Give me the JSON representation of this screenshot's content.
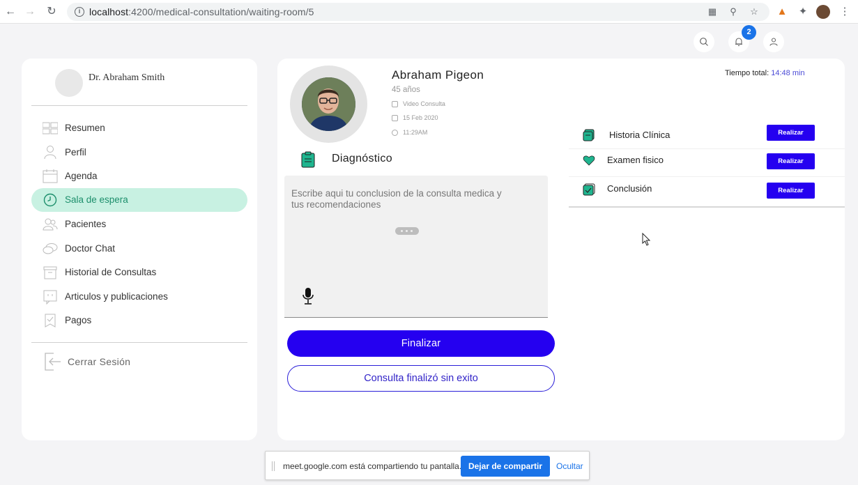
{
  "browser": {
    "url_host": "localhost",
    "url_path": ":4200/medical-consultation/waiting-room/5"
  },
  "header": {
    "notification_count": "2"
  },
  "sidebar": {
    "doctor_name": "Dr. Abraham Smith",
    "items": [
      {
        "label": "Resumen",
        "icon": "grid-icon"
      },
      {
        "label": "Perfil",
        "icon": "user-icon"
      },
      {
        "label": "Agenda",
        "icon": "calendar-icon"
      },
      {
        "label": "Sala de espera",
        "icon": "clock-icon",
        "active": true
      },
      {
        "label": "Pacientes",
        "icon": "patients-icon"
      },
      {
        "label": "Doctor Chat",
        "icon": "chat-icon"
      },
      {
        "label": "Historial de Consultas",
        "icon": "archive-icon"
      },
      {
        "label": "Articulos y publicaciones",
        "icon": "articles-icon"
      },
      {
        "label": "Pagos",
        "icon": "payments-icon"
      }
    ],
    "logout_label": "Cerrar Sesión"
  },
  "patient": {
    "name": "Abraham Pigeon",
    "age": "45 años",
    "consult_type": "Video Consulta",
    "date": "15 Feb 2020",
    "time": "11:29AM"
  },
  "timer": {
    "label": "Tiempo total:",
    "value": "14:48 min"
  },
  "diagnosis": {
    "title": "Diagnóstico",
    "placeholder": "Escribe aqui tu conclusion de la consulta medica y tus recomendaciones"
  },
  "actions": {
    "finalize_label": "Finalizar",
    "unsuccessful_label": "Consulta finalizó sin exito"
  },
  "tasks": [
    {
      "label": "Historia Clínica",
      "icon": "history-icon",
      "button": "Realizar"
    },
    {
      "label": "Examen fisico",
      "icon": "heart-icon",
      "button": "Realizar"
    },
    {
      "label": "Conclusión",
      "icon": "checkbox-icon",
      "button": "Realizar"
    }
  ],
  "share_bar": {
    "message": "meet.google.com está compartiendo tu pantalla.",
    "stop_label": "Dejar de compartir",
    "hide_label": "Ocultar"
  },
  "colors": {
    "primary": "#2500f0",
    "active_menu_bg": "#c8f1e2",
    "active_menu_text": "#1d8f6c",
    "accent_green": "#1fb58f"
  }
}
